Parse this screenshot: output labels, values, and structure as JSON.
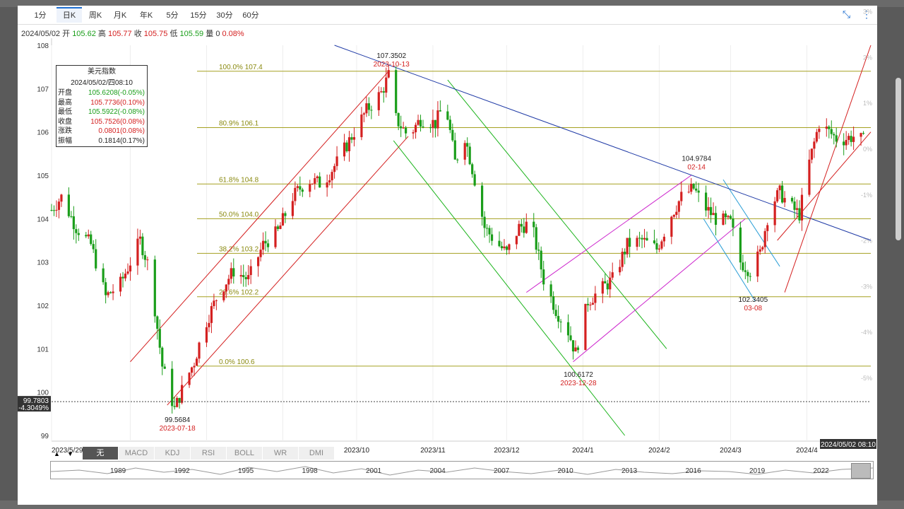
{
  "tabs": [
    "1分",
    "日K",
    "周K",
    "月K",
    "年K",
    "5分",
    "15分",
    "30分",
    "60分"
  ],
  "active_tab": "日K",
  "ohlc_bar": {
    "date": "2024/05/02",
    "open_label": "开",
    "open": "105.62",
    "high_label": "高",
    "high": "105.77",
    "close_label": "收",
    "close": "105.75",
    "low_label": "低",
    "low": "105.59",
    "vol_label": "量",
    "vol": "0",
    "pct": "0.08%"
  },
  "infobox": {
    "title": "美元指数",
    "datetime": "2024/05/02/四08:10",
    "rows": [
      {
        "label": "开盘",
        "value": "105.6208(-0.05%)",
        "color": "#1a9e1a"
      },
      {
        "label": "最高",
        "value": "105.7736(0.10%)",
        "color": "#d42020"
      },
      {
        "label": "最低",
        "value": "105.5922(-0.08%)",
        "color": "#1a9e1a"
      },
      {
        "label": "收盘",
        "value": "105.7526(0.08%)",
        "color": "#d42020"
      },
      {
        "label": "涨跌",
        "value": "0.0801(0.08%)",
        "color": "#d42020"
      },
      {
        "label": "振幅",
        "value": "0.1814(0.17%)",
        "color": "#222222"
      }
    ]
  },
  "indicators": [
    "无",
    "MACD",
    "KDJ",
    "RSI",
    "BOLL",
    "WR",
    "DMI"
  ],
  "active_indicator": "无",
  "navigator_years": [
    "1989",
    "1992",
    "1995",
    "1998",
    "2001",
    "2004",
    "2007",
    "2010",
    "2013",
    "2016",
    "2019",
    "2022"
  ],
  "chart_data": {
    "type": "candlestick",
    "ylim": [
      99,
      108
    ],
    "y_ticks": [
      99,
      100,
      101,
      102,
      103,
      104,
      105,
      106,
      107,
      108
    ],
    "pct_ticks": [
      "4%",
      "3%",
      "2%",
      "1%",
      "0%",
      "-1%",
      "-2%",
      "-3%",
      "-4%",
      "-5%"
    ],
    "pct_values": [
      4,
      3,
      2,
      1,
      0,
      -1,
      -2,
      -3,
      -4,
      -5
    ],
    "x_labels": [
      "2023/5/29",
      "2023/7",
      "2023/8",
      "2023/9",
      "2023/10",
      "2023/11",
      "2023/12",
      "2024/1",
      "2024/2",
      "2024/3",
      "2024/4"
    ],
    "x_label_days": [
      0,
      32,
      63,
      94,
      124,
      155,
      185,
      216,
      247,
      276,
      307
    ],
    "last_date_label": "2024/05/02 08:10",
    "crosshair": {
      "price": "99.7803",
      "pct": "-4.3049%",
      "value": 99.7803
    },
    "fib_levels": [
      {
        "label": "100.0% 107.4",
        "value": 107.4
      },
      {
        "label": "80.9% 106.1",
        "value": 106.1
      },
      {
        "label": "61.8% 104.8",
        "value": 104.8
      },
      {
        "label": "50.0% 104.0",
        "value": 104.0
      },
      {
        "label": "38.2% 103.2",
        "value": 103.2
      },
      {
        "label": "23.6% 102.2",
        "value": 102.2
      },
      {
        "label": "0.0% 100.6",
        "value": 100.6
      }
    ],
    "extremes": [
      {
        "value": "99.5684",
        "date": "2023-07-18",
        "day": 50,
        "price": 99.5684
      },
      {
        "value": "107.3502",
        "date": "2023-10-13",
        "day": 137,
        "price": 107.3502
      },
      {
        "value": "100.6172",
        "date": "2023-12-28",
        "day": 213,
        "price": 100.6172
      },
      {
        "value": "104.9784",
        "date": "02-14",
        "day": 261,
        "price": 104.9784
      },
      {
        "value": "102.3405",
        "date": "03-08",
        "day": 284,
        "price": 102.3405
      }
    ],
    "anchors": [
      {
        "day": 0,
        "price": 104.2
      },
      {
        "day": 4,
        "price": 104.5
      },
      {
        "day": 10,
        "price": 103.8
      },
      {
        "day": 16,
        "price": 103.4
      },
      {
        "day": 22,
        "price": 102.2
      },
      {
        "day": 28,
        "price": 102.5
      },
      {
        "day": 32,
        "price": 103.0
      },
      {
        "day": 36,
        "price": 103.5
      },
      {
        "day": 40,
        "price": 102.8
      },
      {
        "day": 45,
        "price": 100.6
      },
      {
        "day": 50,
        "price": 99.6
      },
      {
        "day": 54,
        "price": 100.2
      },
      {
        "day": 58,
        "price": 100.7
      },
      {
        "day": 62,
        "price": 101.5
      },
      {
        "day": 68,
        "price": 102.3
      },
      {
        "day": 74,
        "price": 102.8
      },
      {
        "day": 80,
        "price": 102.6
      },
      {
        "day": 86,
        "price": 103.4
      },
      {
        "day": 92,
        "price": 103.7
      },
      {
        "day": 98,
        "price": 104.5
      },
      {
        "day": 104,
        "price": 104.9
      },
      {
        "day": 110,
        "price": 104.8
      },
      {
        "day": 116,
        "price": 105.3
      },
      {
        "day": 122,
        "price": 105.9
      },
      {
        "day": 128,
        "price": 106.5
      },
      {
        "day": 134,
        "price": 106.9
      },
      {
        "day": 137,
        "price": 107.3
      },
      {
        "day": 140,
        "price": 106.3
      },
      {
        "day": 145,
        "price": 105.9
      },
      {
        "day": 150,
        "price": 106.3
      },
      {
        "day": 156,
        "price": 106.2
      },
      {
        "day": 160,
        "price": 106.7
      },
      {
        "day": 164,
        "price": 105.3
      },
      {
        "day": 168,
        "price": 105.9
      },
      {
        "day": 172,
        "price": 104.9
      },
      {
        "day": 176,
        "price": 103.8
      },
      {
        "day": 180,
        "price": 103.5
      },
      {
        "day": 185,
        "price": 103.2
      },
      {
        "day": 190,
        "price": 103.8
      },
      {
        "day": 195,
        "price": 103.9
      },
      {
        "day": 200,
        "price": 102.6
      },
      {
        "day": 205,
        "price": 101.9
      },
      {
        "day": 210,
        "price": 101.4
      },
      {
        "day": 213,
        "price": 100.9
      },
      {
        "day": 218,
        "price": 102.1
      },
      {
        "day": 222,
        "price": 102.3
      },
      {
        "day": 228,
        "price": 102.6
      },
      {
        "day": 234,
        "price": 103.4
      },
      {
        "day": 240,
        "price": 103.5
      },
      {
        "day": 246,
        "price": 103.3
      },
      {
        "day": 252,
        "price": 104.1
      },
      {
        "day": 256,
        "price": 104.5
      },
      {
        "day": 261,
        "price": 104.7
      },
      {
        "day": 265,
        "price": 104.3
      },
      {
        "day": 270,
        "price": 104.0
      },
      {
        "day": 276,
        "price": 103.9
      },
      {
        "day": 280,
        "price": 103.0
      },
      {
        "day": 284,
        "price": 102.8
      },
      {
        "day": 288,
        "price": 103.2
      },
      {
        "day": 292,
        "price": 104.3
      },
      {
        "day": 296,
        "price": 104.6
      },
      {
        "day": 300,
        "price": 104.3
      },
      {
        "day": 304,
        "price": 104.1
      },
      {
        "day": 308,
        "price": 105.3
      },
      {
        "day": 312,
        "price": 106.2
      },
      {
        "day": 316,
        "price": 106.0
      },
      {
        "day": 320,
        "price": 105.8
      },
      {
        "day": 326,
        "price": 105.9
      },
      {
        "day": 330,
        "price": 105.8
      }
    ],
    "trend_lines": [
      {
        "color": "#d42020",
        "d1": 32,
        "p1": 100.7,
        "d2": 137,
        "p2": 107.4
      },
      {
        "color": "#d42020",
        "d1": 47,
        "p1": 99.7,
        "d2": 145,
        "p2": 105.9
      },
      {
        "color": "#1ab31a",
        "d1": 139,
        "p1": 105.8,
        "d2": 233,
        "p2": 99.0
      },
      {
        "color": "#1ab31a",
        "d1": 161,
        "p1": 107.2,
        "d2": 250,
        "p2": 101.0
      },
      {
        "color": "#cc22cc",
        "d1": 193,
        "p1": 102.3,
        "d2": 260,
        "p2": 105.0
      },
      {
        "color": "#cc22cc",
        "d1": 212,
        "p1": 100.7,
        "d2": 282,
        "p2": 104.0
      },
      {
        "color": "#2a9ed6",
        "d1": 265,
        "p1": 104.0,
        "d2": 286,
        "p2": 102.1
      },
      {
        "color": "#2a9ed6",
        "d1": 273,
        "p1": 104.9,
        "d2": 296,
        "p2": 102.9
      },
      {
        "color": "#1f3aa6",
        "d1": 115,
        "p1": 108.0,
        "d2": 333,
        "p2": 103.5
      },
      {
        "color": "#d42020",
        "d1": 298,
        "p1": 102.3,
        "d2": 333,
        "p2": 108.0
      },
      {
        "color": "#d42020",
        "d1": 295,
        "p1": 103.5,
        "d2": 333,
        "p2": 106.0
      }
    ]
  }
}
